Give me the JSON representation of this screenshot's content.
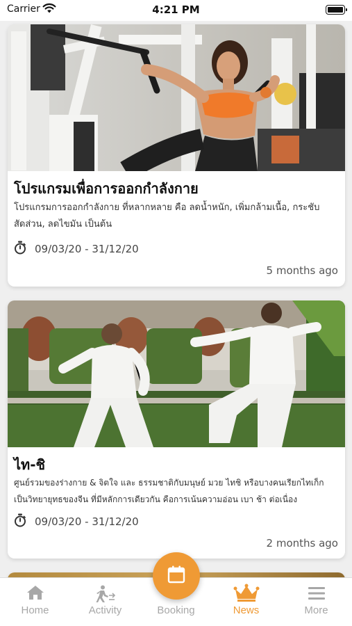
{
  "status_bar": {
    "carrier": "Carrier",
    "time": "4:21 PM"
  },
  "feed": {
    "items": [
      {
        "title": "โปรแกรมเพื่อการออกกำลังกาย",
        "description": "โปรแกรมการออกกำลังกาย ที่หลากหลาย คือ ลดน้ำหนัก, เพิ่มกล้ามเนื้อ, กระชับสัดส่วน, ลดไขมัน เป็นต้น",
        "date_range": "09/03/20 - 31/12/20",
        "posted_ago": "5 months ago",
        "image": "gym-workout-photo"
      },
      {
        "title": "ไท-ชิ",
        "description": "ศูนย์รวมของร่างกาย & จิตใจ และ ธรรมชาติกับมนุษย์ มวย ไทชิ หรือบางคนเรียกไทเก็ก เป็นวิทยายุทธของจีน ที่มีหลักการเดียวกัน คือการเน้นความอ่อน เบา ช้า ต่อเนื่อง",
        "date_range": "09/03/20 - 31/12/20",
        "posted_ago": "2 months ago",
        "image": "tai-chi-photo"
      }
    ]
  },
  "tab_bar": {
    "active": "News",
    "accent_color": "#ef9a35",
    "tabs": [
      {
        "label": "Home",
        "icon": "home-icon"
      },
      {
        "label": "Activity",
        "icon": "activity-icon"
      },
      {
        "label": "Booking",
        "icon": "calendar-icon"
      },
      {
        "label": "News",
        "icon": "crown-icon"
      },
      {
        "label": "More",
        "icon": "menu-icon"
      }
    ]
  }
}
